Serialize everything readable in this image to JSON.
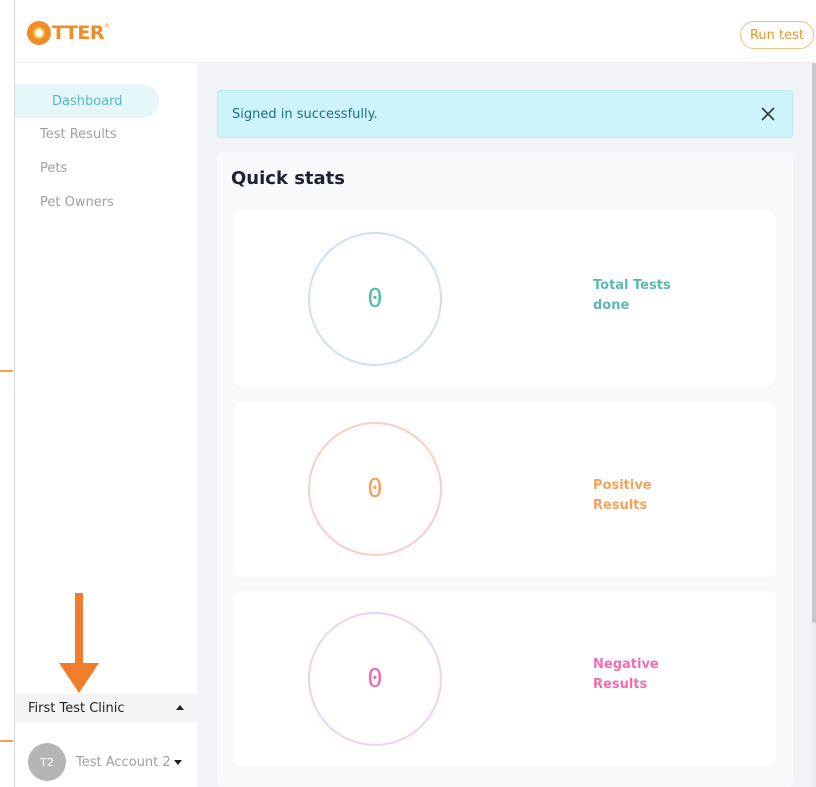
{
  "header": {
    "logo_text": "TTER",
    "logo_tm": "®",
    "run_test_label": "Run test"
  },
  "sidebar": {
    "items": [
      {
        "label": "Dashboard",
        "active": true
      },
      {
        "label": "Test Results",
        "active": false
      },
      {
        "label": "Pets",
        "active": false
      },
      {
        "label": "Pet Owners",
        "active": false
      }
    ],
    "clinic": "First Test Clinic",
    "account": {
      "initials": "T2",
      "name": "Test Account 2"
    }
  },
  "alert": {
    "message": "Signed in successfully."
  },
  "quick_stats": {
    "title": "Quick stats",
    "stats": [
      {
        "value": "0",
        "label": "Total Tests done",
        "color": "#5cb8b2",
        "ring": "#cfe0f3"
      },
      {
        "value": "0",
        "label": "Positive Results",
        "color": "#f5a25d",
        "ring": "#f9cdc8"
      },
      {
        "value": "0",
        "label": "Negative Results",
        "color": "#ec6fb1",
        "ring": "#e8d4ee"
      }
    ]
  },
  "colors": {
    "brand_orange": "#f28c28",
    "accent_teal": "#58b7c4",
    "alert_bg": "#cdf4fb"
  }
}
